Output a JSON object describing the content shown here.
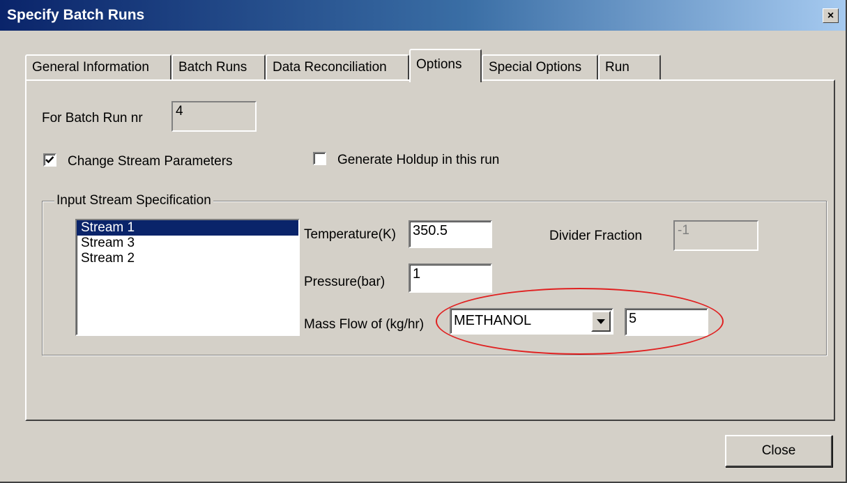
{
  "window": {
    "title": "Specify Batch Runs",
    "close_glyph": "×"
  },
  "tabs": [
    {
      "label": "General Information",
      "active": false
    },
    {
      "label": "Batch Runs",
      "active": false
    },
    {
      "label": "Data Reconciliation",
      "active": false
    },
    {
      "label": "Options",
      "active": true
    },
    {
      "label": "Special Options",
      "active": false
    },
    {
      "label": "Run",
      "active": false
    }
  ],
  "options": {
    "batch_run_label": "For Batch Run nr",
    "batch_run_value": "4",
    "change_stream_label": "Change Stream Parameters",
    "change_stream_checked": true,
    "generate_holdup_label": "Generate Holdup in this run",
    "generate_holdup_checked": false,
    "group_title": "Input Stream Specification",
    "streams": [
      {
        "label": "Stream 1",
        "selected": true
      },
      {
        "label": "Stream 3",
        "selected": false
      },
      {
        "label": "Stream 2",
        "selected": false
      }
    ],
    "temperature_label": "Temperature(K)",
    "temperature_value": "350.5",
    "pressure_label": "Pressure(bar)",
    "pressure_value": "1",
    "massflow_label": "Mass Flow of (kg/hr)",
    "massflow_component": "METHANOL",
    "massflow_value": "5",
    "divider_label": "Divider Fraction",
    "divider_value": "-1"
  },
  "footer": {
    "close_label": "Close"
  },
  "colors": {
    "highlight": "#e02020",
    "titlebar_start": "#0a246a",
    "selection": "#0a246a"
  }
}
